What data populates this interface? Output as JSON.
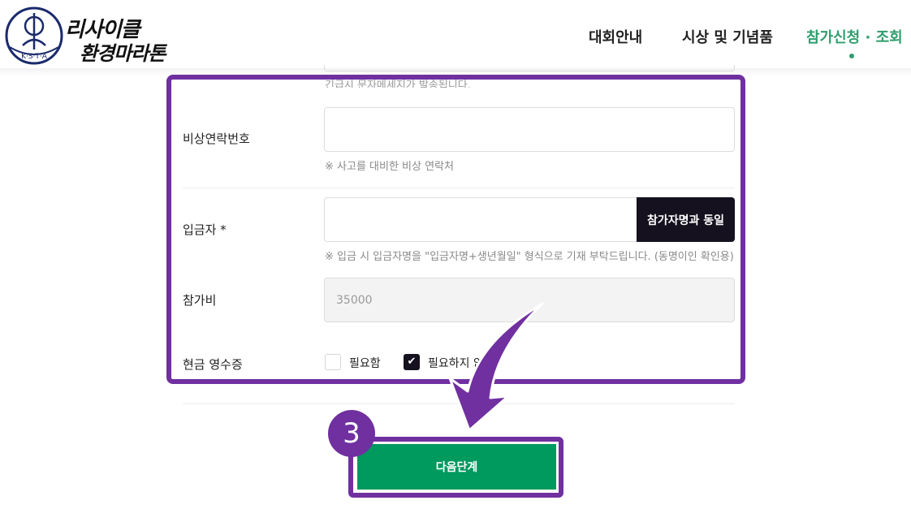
{
  "header": {
    "logo": {
      "line1": "리사이클",
      "line2": "환경마라톤",
      "mark_text": "K·S·T·A"
    },
    "nav": [
      {
        "label": "대회안내"
      },
      {
        "label": "시상 및 기념품"
      },
      {
        "label": "참가신청 · 조회"
      }
    ],
    "active_color": "#2e9e6e"
  },
  "form": {
    "cut_hint": "긴급시 문자메세지가 발송됩니다.",
    "emergency": {
      "label": "비상연락번호",
      "value": "",
      "hint": "※ 사고를 대비한 비상 연락처"
    },
    "depositor": {
      "label": "입금자 *",
      "value": "",
      "same_button": "참가자명과 동일",
      "hint": "※ 입금 시 입금자명을 \"입금자명+생년월일\" 형식으로 기재 부탁드립니다. (동명이인 확인용)"
    },
    "fee": {
      "label": "참가비",
      "value": "35000"
    },
    "receipt": {
      "label": "현금 영수증",
      "options": [
        {
          "label": "필요함",
          "checked": false
        },
        {
          "label": "필요하지 않음",
          "checked": true
        }
      ]
    }
  },
  "next_button": "다음단계",
  "annotation": {
    "step_number": "3",
    "color": "#7030a0"
  }
}
